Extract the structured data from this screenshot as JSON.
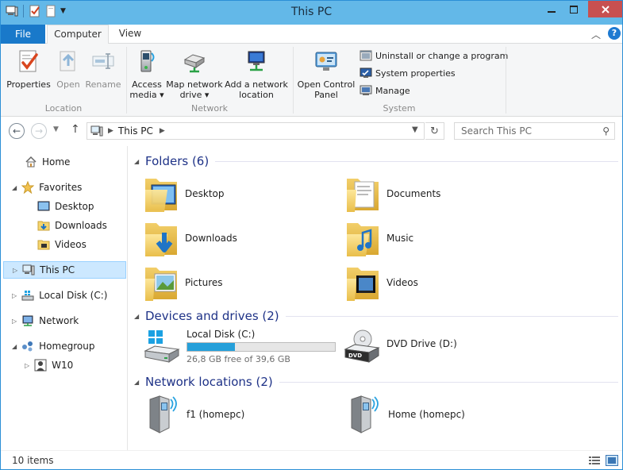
{
  "window": {
    "title": "This PC"
  },
  "ribbon": {
    "tabs": {
      "file": "File",
      "computer": "Computer",
      "view": "View"
    },
    "location": {
      "label": "Location",
      "properties": "Properties",
      "open": "Open",
      "rename": "Rename"
    },
    "network": {
      "label": "Network",
      "access_media_1": "Access",
      "access_media_2": "media ▾",
      "map_drive_1": "Map network",
      "map_drive_2": "drive ▾",
      "add_location_1": "Add a network",
      "add_location_2": "location"
    },
    "system": {
      "label": "System",
      "control_panel_1": "Open Control",
      "control_panel_2": "Panel",
      "uninstall": "Uninstall or change a program",
      "system_properties": "System properties",
      "manage": "Manage"
    }
  },
  "address": {
    "path": "This PC",
    "search_placeholder": "Search This PC"
  },
  "nav": {
    "home": "Home",
    "favorites": "Favorites",
    "fav_desktop": "Desktop",
    "fav_downloads": "Downloads",
    "fav_videos": "Videos",
    "this_pc": "This PC",
    "local_disk": "Local Disk (C:)",
    "network": "Network",
    "homegroup": "Homegroup",
    "w10": "W10"
  },
  "folders": {
    "header": "Folders (6)",
    "items": [
      "Desktop",
      "Documents",
      "Downloads",
      "Music",
      "Pictures",
      "Videos"
    ]
  },
  "drives": {
    "header": "Devices and drives (2)",
    "local": {
      "name": "Local Disk (C:)",
      "free": "26,8 GB free of 39,6 GB",
      "used_fraction": 0.32
    },
    "dvd": {
      "name": "DVD Drive (D:)"
    }
  },
  "netlocs": {
    "header": "Network locations (2)",
    "items": [
      "f1 (homepc)",
      "Home (homepc)"
    ]
  },
  "status": {
    "items": "10 items"
  },
  "colors": {
    "accent": "#1979ca",
    "title_bar": "#63b8e8",
    "selection": "#cce8ff",
    "group_header": "#1e3287",
    "drive_bar": "#26a0da"
  }
}
